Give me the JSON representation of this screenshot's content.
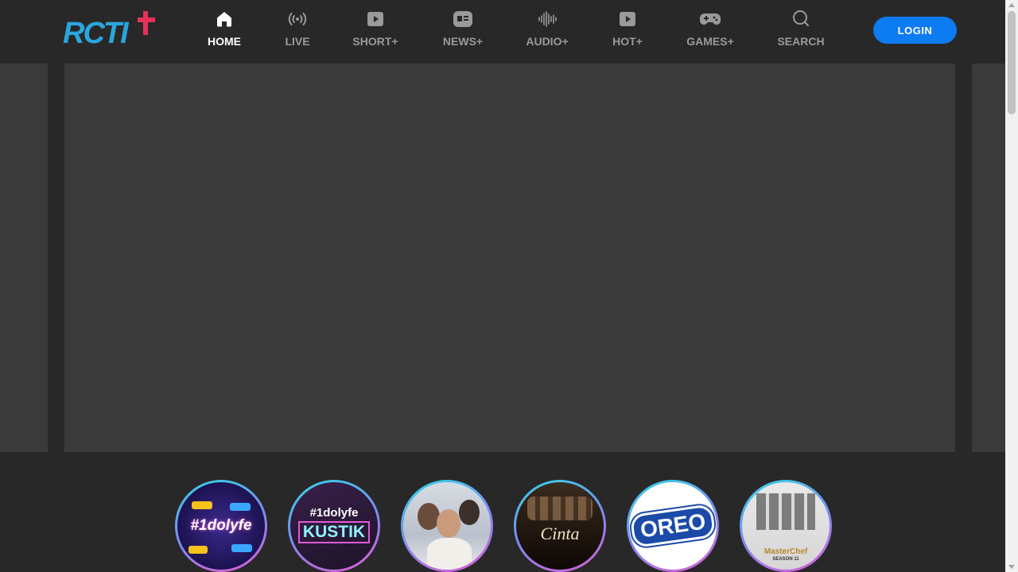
{
  "brand": {
    "logo_text": "RCTI+",
    "logo_primary": "#2aa6dd",
    "logo_accent": "#e8305b"
  },
  "nav": {
    "items": [
      {
        "label": "HOME",
        "icon": "home-icon",
        "active": true
      },
      {
        "label": "LIVE",
        "icon": "broadcast-icon",
        "active": false
      },
      {
        "label": "SHORT+",
        "icon": "video-play-icon",
        "active": false
      },
      {
        "label": "NEWS+",
        "icon": "newspaper-icon",
        "active": false
      },
      {
        "label": "AUDIO+",
        "icon": "sound-wave-icon",
        "active": false
      },
      {
        "label": "HOT+",
        "icon": "video-play-icon",
        "active": false
      },
      {
        "label": "GAMES+",
        "icon": "gamepad-icon",
        "active": false
      },
      {
        "label": "SEARCH",
        "icon": "search-icon",
        "active": false
      }
    ]
  },
  "header": {
    "login_label": "LOGIN",
    "login_color": "#0d7bf2"
  },
  "stories": [
    {
      "title": "#1dolyfe",
      "icon": "idolyfe-thumbnail"
    },
    {
      "title": "#1dolyfe",
      "subtitle": "KUSTIK",
      "icon": "idolyfe-kustik-thumbnail"
    },
    {
      "title": "",
      "icon": "drama-couple-thumbnail"
    },
    {
      "title": "Cinta",
      "icon": "ikatan-cinta-thumbnail"
    },
    {
      "title": "OREO",
      "icon": "oreo-thumbnail"
    },
    {
      "title": "MasterChef",
      "subtitle": "SEASON 11",
      "icon": "masterchef-thumbnail"
    }
  ],
  "colors": {
    "background": "#282828",
    "banner": "#3a3a3a",
    "active_nav": "#ffffff",
    "inactive_nav": "#9a9a9a"
  }
}
